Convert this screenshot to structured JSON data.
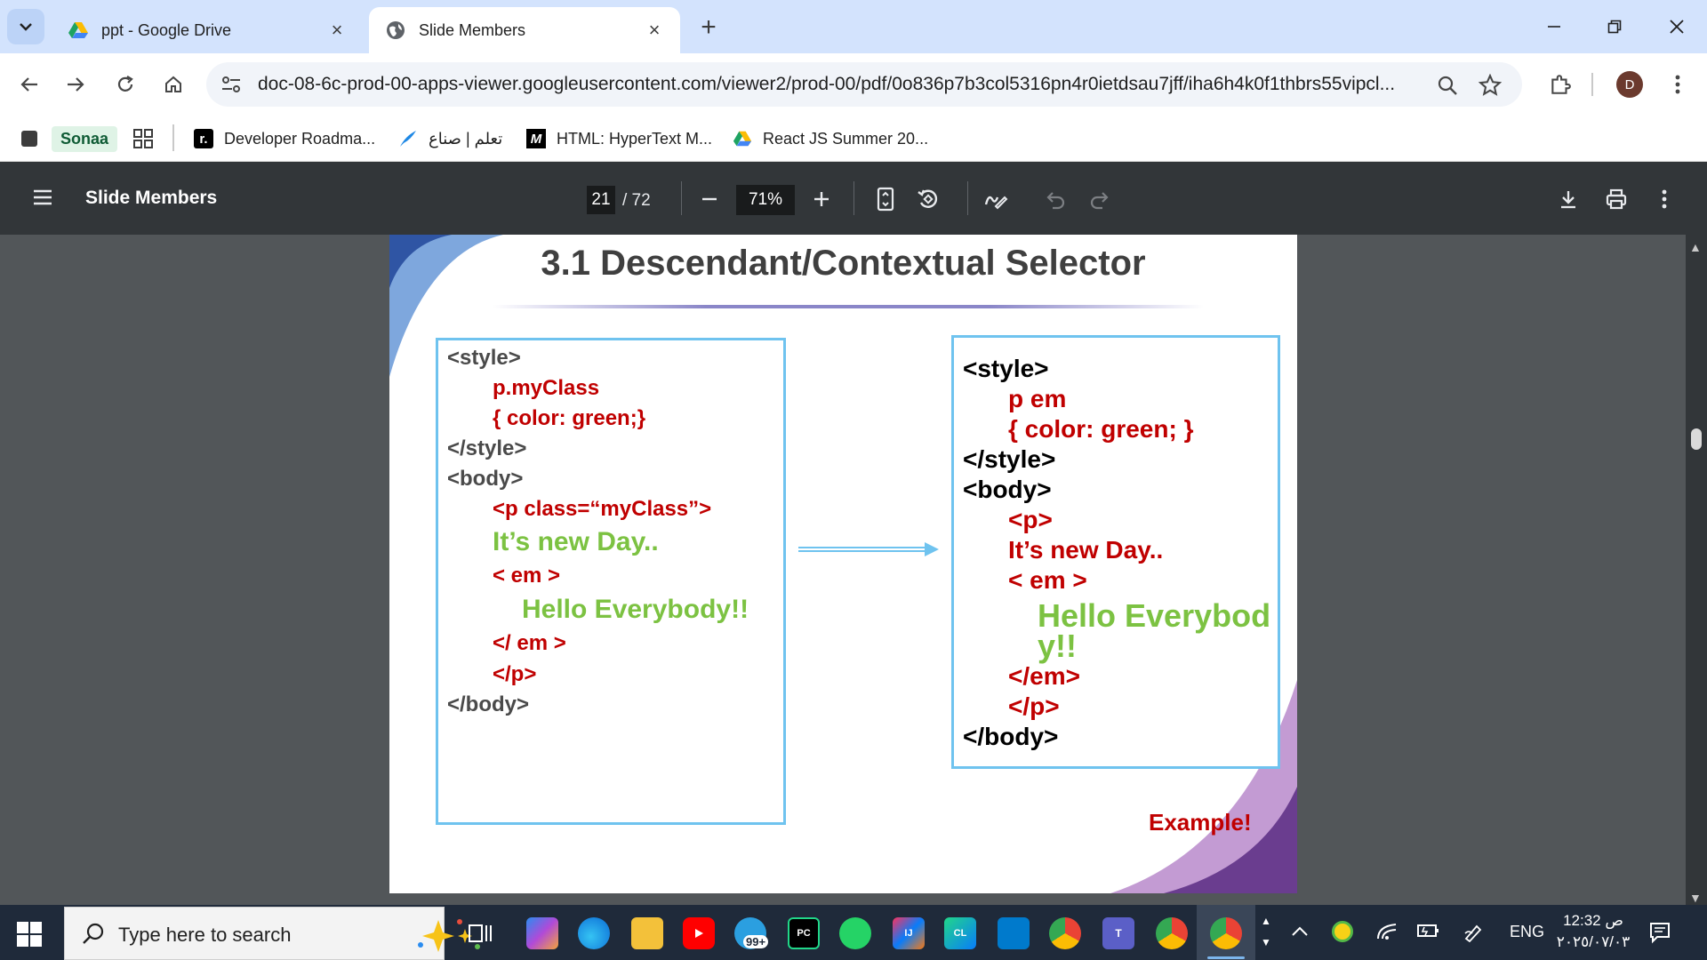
{
  "browser": {
    "tabs": [
      {
        "title": "ppt - Google Drive",
        "active": false,
        "favicon": "google-drive-icon"
      },
      {
        "title": "Slide Members",
        "active": true,
        "favicon": "globe-icon"
      }
    ],
    "address": {
      "url": "doc-08-6c-prod-00-apps-viewer.googleusercontent.com/viewer2/prod-00/pdf/0o836p7b3col5316pn4r0ietdsau7jff/iha6h4k0f1thbrs55vipcl..."
    },
    "profile_initial": "D",
    "bookmarks": [
      {
        "label": "",
        "icon": "square-icon"
      },
      {
        "label": "Sonaa",
        "icon": "sonaa-badge"
      },
      {
        "label": "",
        "icon": "apps-grid-icon"
      },
      {
        "label": "Developer Roadma...",
        "icon": "roadmap-icon"
      },
      {
        "label": "تعلم | صناع",
        "icon": "quill-icon"
      },
      {
        "label": "HTML: HyperText M...",
        "icon": "mdn-icon"
      },
      {
        "label": "React JS Summer 20...",
        "icon": "google-drive-icon"
      }
    ]
  },
  "pdf_viewer": {
    "title": "Slide Members",
    "current_page": "21",
    "total_pages": "/ 72",
    "zoom": "71%"
  },
  "slide": {
    "title": "3.1 Descendant/Contextual Selector",
    "left_code": [
      "<style>",
      "p.myClass",
      "{ color: green;}",
      "</style>",
      "<body>",
      "<p class=“myClass”>",
      "It’s new Day..",
      "< em >",
      "Hello Everybody!!",
      "</ em >",
      "</p>",
      "</body>"
    ],
    "right_code": [
      "<style>",
      "p em",
      "{ color: green; }",
      "</style>",
      "<body>",
      "<p>",
      "It’s new Day..",
      "< em >",
      "Hello Everybod",
      "y!!",
      "</em>",
      "</p>",
      "</body>"
    ],
    "example_label": "Example!",
    "colors": {
      "red": "#c00000",
      "green": "#7cc242",
      "box_border": "#6fc3ef",
      "arrow": "#6fc3ef"
    }
  },
  "taskbar": {
    "search_placeholder": "Type here to search",
    "mail_badge": "99+",
    "tray_language": "ENG",
    "time": "12:32 ص",
    "date": "٢٠٢٥/٠٧/٠٣"
  }
}
